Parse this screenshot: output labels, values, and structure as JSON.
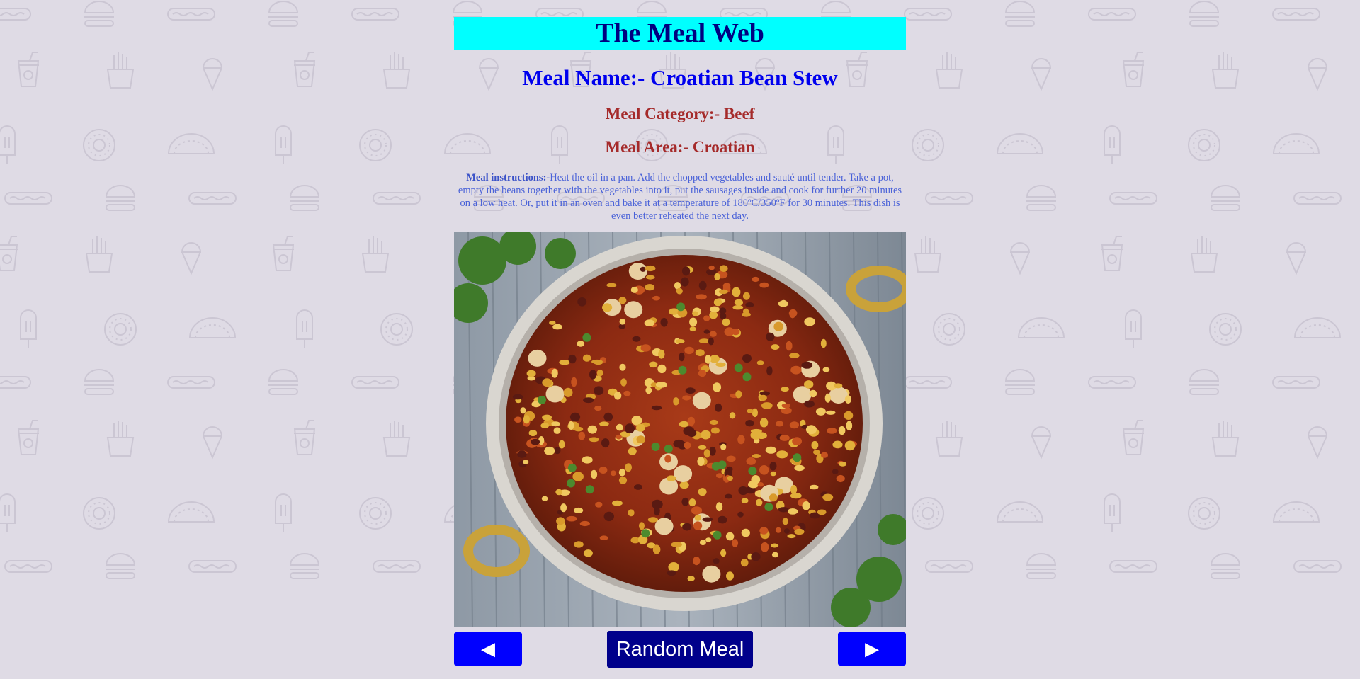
{
  "site": {
    "title": "The Meal Web"
  },
  "meal": {
    "name_text": "Meal Name:- Croatian Bean Stew",
    "category_text": "Meal Category:- Beef",
    "area_text": "Meal Area:- Croatian",
    "instructions_label": "Meal instructions:-",
    "instructions": "Heat the oil in a pan. Add the chopped vegetables and sauté until tender. Take a pot, empty the beans together with the vegetables into it, put the sausages inside and cook for further 20 minutes on a low heat. Or, put it in an oven and bake it at a temperature of 180ºC/350ºF for 30 minutes. This dish is even better reheated the next day.",
    "image_alt": "Croatian Bean Stew"
  },
  "controls": {
    "prev_label": "◀",
    "random_label": "Random Meal",
    "next_label": "▶"
  },
  "colors": {
    "background": "#dfdbe5",
    "title_bg": "#00ffff",
    "title_text": "#000080",
    "name_text": "#0000ee",
    "category_text": "#a52a2a",
    "instructions_text": "#4a62d8",
    "nav_button": "#0000ff",
    "random_button": "#00008b"
  },
  "background_pattern_icons": [
    "burger-icon",
    "hotdog-icon",
    "drink-cup-icon",
    "fries-icon",
    "ice-cream-cone-icon",
    "popsicle-icon",
    "donut-icon",
    "taco-icon"
  ]
}
